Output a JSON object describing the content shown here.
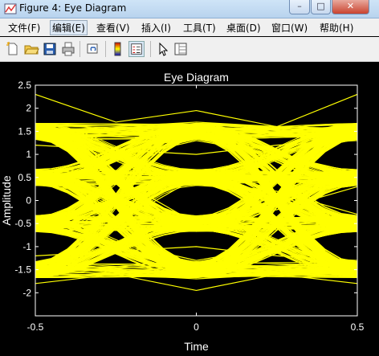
{
  "window": {
    "title": "Figure 4: Eye Diagram",
    "minimize": "–",
    "maximize": "□",
    "close": "✕"
  },
  "menu": [
    {
      "label": "文件(F)"
    },
    {
      "label": "编辑(E)"
    },
    {
      "label": "查看(V)"
    },
    {
      "label": "插入(I)"
    },
    {
      "label": "工具(T)"
    },
    {
      "label": "桌面(D)"
    },
    {
      "label": "窗口(W)"
    },
    {
      "label": "帮助(H)"
    }
  ],
  "toolbar": {
    "icons": [
      "new-figure-icon",
      "open-folder-icon",
      "save-icon",
      "print-icon",
      "link-plot-icon",
      "colorbar-icon",
      "legend-icon",
      "pointer-icon",
      "property-editor-icon"
    ]
  },
  "colors": {
    "background": "#000000",
    "trace": "#ffff00",
    "axes": "#ffffff"
  },
  "chart_data": {
    "type": "line",
    "title": "Eye Diagram",
    "xlabel": "Time",
    "ylabel": "Amplitude",
    "xlim": [
      -0.5,
      0.5
    ],
    "ylim": [
      -2.5,
      2.5
    ],
    "xticks": [
      "-0.5",
      "0",
      "0.5"
    ],
    "yticks": [
      "2.5",
      "2",
      "1.5",
      "1",
      "0.5",
      "0",
      "-0.5",
      "-1",
      "-1.5",
      "-2"
    ],
    "grid": false,
    "series": [
      {
        "x": [
          -0.5,
          -0.25,
          0,
          0.25,
          0.5
        ],
        "values": [
          1.5,
          1.6,
          1.7,
          1.6,
          1.5
        ]
      },
      {
        "x": [
          -0.5,
          -0.25,
          0,
          0.25,
          0.5
        ],
        "values": [
          1.5,
          0.5,
          -0.5,
          -1.0,
          -1.4
        ]
      },
      {
        "x": [
          -0.5,
          -0.25,
          0,
          0.25,
          0.5
        ],
        "values": [
          -1.5,
          -0.5,
          0.5,
          1.0,
          1.4
        ]
      },
      {
        "x": [
          -0.5,
          -0.25,
          0,
          0.25,
          0.5
        ],
        "values": [
          -1.5,
          -1.6,
          -1.7,
          -1.6,
          -1.5
        ]
      },
      {
        "x": [
          -0.5,
          -0.25,
          0,
          0.25,
          0.5
        ],
        "values": [
          0.5,
          0.9,
          1.3,
          1.0,
          0.6
        ]
      },
      {
        "x": [
          -0.5,
          -0.25,
          0,
          0.25,
          0.5
        ],
        "values": [
          -0.5,
          -0.9,
          -1.3,
          -1.0,
          -0.6
        ]
      },
      {
        "x": [
          -0.5,
          -0.25,
          0,
          0.25,
          0.5
        ],
        "values": [
          0.5,
          0.0,
          -0.4,
          -0.2,
          0.3
        ]
      },
      {
        "x": [
          -0.5,
          -0.25,
          0,
          0.25,
          0.5
        ],
        "values": [
          -0.5,
          0.0,
          0.4,
          0.2,
          -0.3
        ]
      },
      {
        "x": [
          -0.5,
          -0.25,
          0,
          0.25,
          0.5
        ],
        "values": [
          2.3,
          1.7,
          1.95,
          1.6,
          2.3
        ]
      },
      {
        "x": [
          -0.5,
          -0.25,
          0,
          0.25,
          0.5
        ],
        "values": [
          -1.8,
          -1.6,
          -1.95,
          -1.6,
          -1.8
        ]
      },
      {
        "x": [
          -0.5,
          -0.25,
          0,
          0.25,
          0.5
        ],
        "values": [
          1.2,
          1.1,
          1.0,
          1.2,
          1.3
        ]
      },
      {
        "x": [
          -0.5,
          -0.25,
          0,
          0.25,
          0.5
        ],
        "values": [
          -1.2,
          -1.1,
          -1.0,
          -1.2,
          -1.3
        ]
      }
    ]
  }
}
